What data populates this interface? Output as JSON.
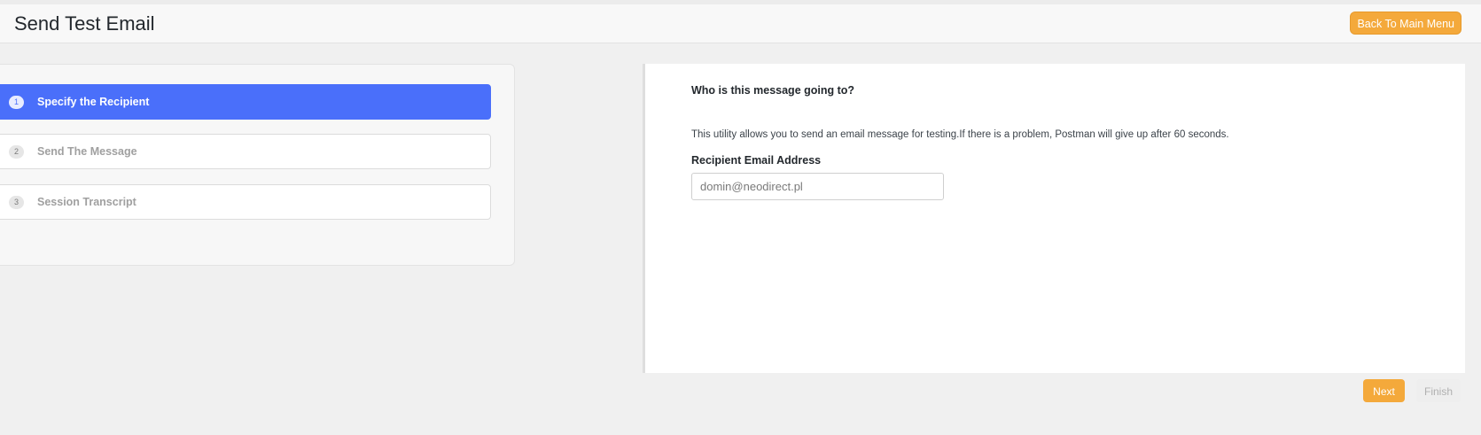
{
  "header": {
    "title": "Send Test Email",
    "back_button_label": "Back To Main Menu"
  },
  "steps": [
    {
      "number": "1",
      "label": "Specify the Recipient",
      "active": true
    },
    {
      "number": "2",
      "label": "Send The Message",
      "active": false
    },
    {
      "number": "3",
      "label": "Session Transcript",
      "active": false
    }
  ],
  "main": {
    "question": "Who is this message going to?",
    "description": "This utility allows you to send an email message for testing.If there is a problem, Postman will give up after 60 seconds.",
    "recipient_label": "Recipient Email Address",
    "recipient_value": "domin@neodirect.pl"
  },
  "footer": {
    "next_label": "Next",
    "finish_label": "Finish"
  },
  "colors": {
    "accent": "#f4a93b",
    "active_step": "#4a6ffa"
  }
}
